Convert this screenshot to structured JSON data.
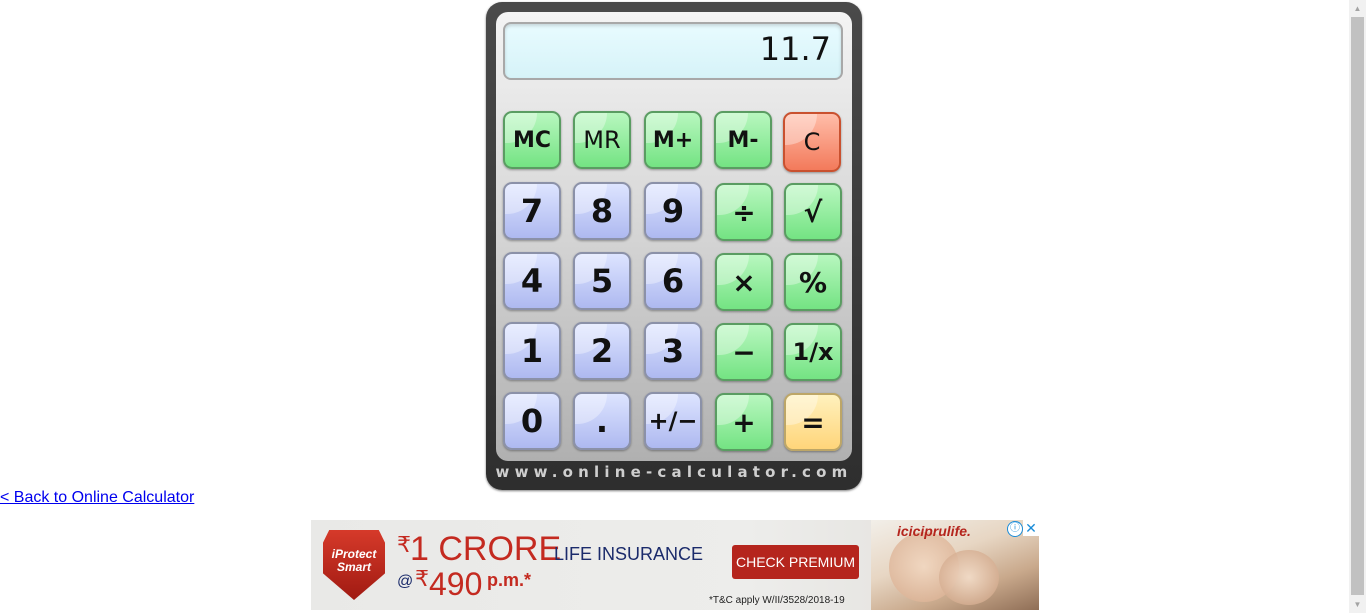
{
  "calculator": {
    "display": "11.7",
    "brand": "www.online-calculator.com",
    "buttons": {
      "mc": "MC",
      "mr": "MR",
      "mplus": "M+",
      "mminus": "M-",
      "clear": "C",
      "n7": "7",
      "n8": "8",
      "n9": "9",
      "divide": "÷",
      "sqrt": "√",
      "n4": "4",
      "n5": "5",
      "n6": "6",
      "multiply": "×",
      "percent": "%",
      "n1": "1",
      "n2": "2",
      "n3": "3",
      "minus": "−",
      "reciprocal": "1/x",
      "n0": "0",
      "decimal": ".",
      "plusminus": "+/−",
      "plus": "+",
      "equals": "="
    },
    "colors": {
      "memory": "#74e383",
      "digit": "#aeb9f0",
      "clear": "#f37a5b",
      "equals": "#ffd57a"
    }
  },
  "nav": {
    "back_link": "< Back to Online Calculator"
  },
  "ad": {
    "badge_top": "iProtect",
    "badge_bottom": "Smart",
    "rupee": "₹",
    "amount": "1 CRORE",
    "product": "LIFE INSURANCE",
    "at": "@",
    "price": "490",
    "period": "p.m.*",
    "cta": "CHECK PREMIUM",
    "terms": "*T&C apply W/II/3528/2018-19",
    "logo": "iciciprulife.",
    "info_icon": "ⓘ",
    "close_icon": "✕"
  },
  "scrollbar": {
    "up": "▲",
    "down": "▼"
  }
}
